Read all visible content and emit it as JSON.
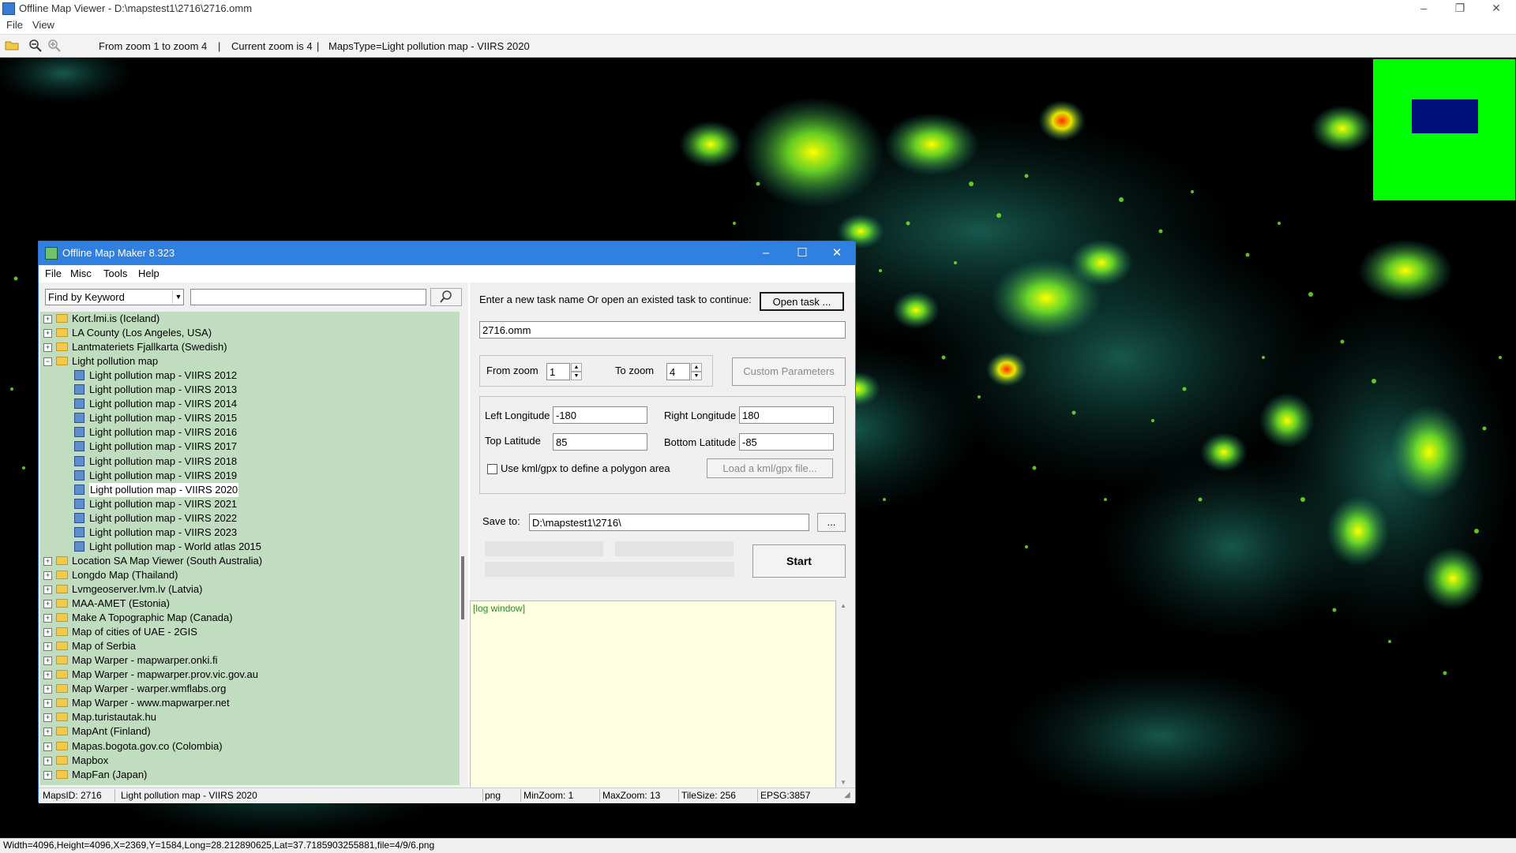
{
  "viewer": {
    "title": "Offline Map Viewer - D:\\mapstest1\\2716\\2716.omm",
    "menu": [
      "File",
      "View"
    ],
    "toolbar_info": {
      "zoom_range": "From zoom 1 to zoom 4",
      "current_zoom": "Current zoom is 4",
      "maps_type": "MapsType=Light pollution map - VIIRS 2020"
    },
    "status_text": "Width=4096,Height=4096,X=2369,Y=1584,Long=28.212890625,Lat=37.7185903255881,file=4/9/6.png",
    "controls": {
      "minimize": "–",
      "maximize": "❐",
      "close": "✕"
    }
  },
  "dialog": {
    "title": "Offline Map Maker 8.323",
    "menu": [
      "File",
      "Misc",
      "Tools",
      "Help"
    ],
    "controls": {
      "minimize": "–",
      "maximize": "☐",
      "close": "✕"
    },
    "search": {
      "mode": "Find by Keyword",
      "value": ""
    },
    "tree": [
      {
        "label": "Kort.lmi.is (Iceland)",
        "type": "folder",
        "expander": "+"
      },
      {
        "label": "LA County (Los Angeles, USA)",
        "type": "folder",
        "expander": "+"
      },
      {
        "label": "Lantmateriets Fjallkarta (Swedish)",
        "type": "folder",
        "expander": "+"
      },
      {
        "label": "Light pollution map",
        "type": "folder",
        "expander": "−"
      },
      {
        "label": "Light pollution map - VIIRS 2012",
        "type": "map"
      },
      {
        "label": "Light pollution map - VIIRS 2013",
        "type": "map"
      },
      {
        "label": "Light pollution map - VIIRS 2014",
        "type": "map"
      },
      {
        "label": "Light pollution map - VIIRS 2015",
        "type": "map"
      },
      {
        "label": "Light pollution map - VIIRS 2016",
        "type": "map"
      },
      {
        "label": "Light pollution map - VIIRS 2017",
        "type": "map"
      },
      {
        "label": "Light pollution map - VIIRS 2018",
        "type": "map"
      },
      {
        "label": "Light pollution map - VIIRS 2019",
        "type": "map"
      },
      {
        "label": "Light pollution map - VIIRS 2020",
        "type": "map",
        "selected": true
      },
      {
        "label": "Light pollution map - VIIRS 2021",
        "type": "map"
      },
      {
        "label": "Light pollution map - VIIRS 2022",
        "type": "map"
      },
      {
        "label": "Light pollution map - VIIRS 2023",
        "type": "map"
      },
      {
        "label": "Light pollution map - World atlas 2015",
        "type": "map"
      },
      {
        "label": "Location SA Map Viewer (South Australia)",
        "type": "folder",
        "expander": "+"
      },
      {
        "label": "Longdo Map (Thailand)",
        "type": "folder",
        "expander": "+"
      },
      {
        "label": "Lvmgeoserver.lvm.lv (Latvia)",
        "type": "folder",
        "expander": "+"
      },
      {
        "label": "MAA-AMET (Estonia)",
        "type": "folder",
        "expander": "+"
      },
      {
        "label": "Make A Topographic Map (Canada)",
        "type": "folder",
        "expander": "+"
      },
      {
        "label": "Map of cities of UAE - 2GIS",
        "type": "folder",
        "expander": "+"
      },
      {
        "label": "Map of Serbia",
        "type": "folder",
        "expander": "+"
      },
      {
        "label": "Map Warper - mapwarper.onki.fi",
        "type": "folder",
        "expander": "+"
      },
      {
        "label": "Map Warper - mapwarper.prov.vic.gov.au",
        "type": "folder",
        "expander": "+"
      },
      {
        "label": "Map Warper - warper.wmflabs.org",
        "type": "folder",
        "expander": "+"
      },
      {
        "label": "Map Warper - www.mapwarper.net",
        "type": "folder",
        "expander": "+"
      },
      {
        "label": "Map.turistautak.hu",
        "type": "folder",
        "expander": "+"
      },
      {
        "label": "MapAnt (Finland)",
        "type": "folder",
        "expander": "+"
      },
      {
        "label": "Mapas.bogota.gov.co (Colombia)",
        "type": "folder",
        "expander": "+"
      },
      {
        "label": "Mapbox",
        "type": "folder",
        "expander": "+"
      },
      {
        "label": "MapFan (Japan)",
        "type": "folder",
        "expander": "+"
      }
    ],
    "task": {
      "prompt": "Enter a new task name Or open an existed task to continue:",
      "open_button": "Open task ...",
      "name": "2716.omm"
    },
    "zoom": {
      "from_label": "From zoom",
      "from_value": "1",
      "to_label": "To zoom",
      "to_value": "4",
      "custom_button": "Custom Parameters"
    },
    "bounds": {
      "left_label": "Left Longitude",
      "left_value": "-180",
      "right_label": "Right Longitude",
      "right_value": "180",
      "top_label": "Top Latitude",
      "top_value": "85",
      "bottom_label": "Bottom Latitude",
      "bottom_value": "-85",
      "kml_checkbox": "Use kml/gpx to define a polygon area",
      "kml_checked": false,
      "kml_button": "Load a kml/gpx file..."
    },
    "save": {
      "label": "Save to:",
      "path": "D:\\mapstest1\\2716\\",
      "browse": "..."
    },
    "start_button": "Start",
    "log_text": "[log window]",
    "status": {
      "maps_id": "MapsID: 2716",
      "map_name": "Light pollution map - VIIRS 2020",
      "format": "png",
      "min_zoom": "MinZoom: 1",
      "max_zoom": "MaxZoom: 13",
      "tile_size": "TileSize: 256",
      "epsg": "EPSG:3857"
    }
  },
  "colors": {
    "map_background": "#000000",
    "light_core": "#ffff00",
    "light_mid": "#7fff2a",
    "light_dim": "#1e8f7a",
    "overview_bg": "#00ff00",
    "overview_view": "#00107a",
    "tree_bg": "#c1ddc0",
    "dialog_title": "#2f80e0"
  }
}
